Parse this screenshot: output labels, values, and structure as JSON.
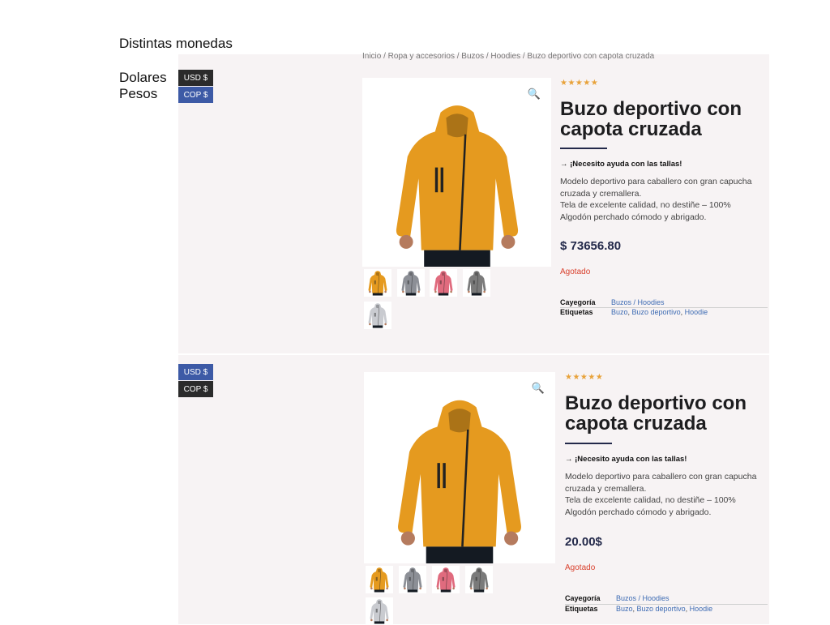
{
  "document": {
    "title": "Distintas monedas",
    "labels": [
      "Dolares",
      "Pesos"
    ]
  },
  "colors": {
    "hoodie": "#e59a1f",
    "hoodie_gray": "#8c8f96",
    "hoodie_pink": "#e06b7e",
    "hoodie_darkgray": "#7a7a7a",
    "hoodie_light": "#c9cbd0",
    "price": "#23294a",
    "stock": "#d9412e",
    "link": "#3d6bb3",
    "stars": "#e8a23a",
    "currency_active": "#3d5aa6",
    "currency_inactive": "#2b2b2b"
  },
  "panels": [
    {
      "currency_buttons": [
        "USD $",
        "COP $"
      ],
      "active_currency": "COP $",
      "breadcrumb": "Inicio / Ropa y accesorios / Buzos / Hoodies / Buzo deportivo con capota cruzada",
      "rating_stars": "★★★★★",
      "rating": 5,
      "product_title": "Buzo deportivo con capota cruzada",
      "help_link": "¡Necesito ayuda con las tallas!",
      "description": [
        "Modelo deportivo para caballero con gran capucha",
        "cruzada y cremallera.",
        "Tela de excelente calidad, no destiñe – 100%",
        "Algodón perchado cómodo y abrigado."
      ],
      "price": "$ 73656.80",
      "stock_status": "Agotado",
      "meta": {
        "category_label": "Cayegoría",
        "category_value": "Buzos / Hoodies",
        "tags_label": "Etiquetas",
        "tags": [
          "Buzo",
          "Buzo deportivo",
          "Hoodie"
        ]
      },
      "thumbnails": [
        "orange-hoodie",
        "gray-hoodie",
        "pink-hoodie",
        "darkgray-hoodie",
        "light-hoodie"
      ]
    },
    {
      "currency_buttons": [
        "USD $",
        "COP $"
      ],
      "active_currency": "USD $",
      "rating_stars": "★★★★★",
      "rating": 5,
      "product_title": "Buzo deportivo con capota cruzada",
      "help_link": "¡Necesito ayuda con las tallas!",
      "description": [
        "Modelo deportivo para caballero con gran capucha",
        "cruzada y cremallera.",
        "Tela de excelente calidad, no destiñe – 100%",
        "Algodón perchado cómodo y abrigado."
      ],
      "price": "20.00$",
      "stock_status": "Agotado",
      "meta": {
        "category_label": "Cayegoría",
        "category_value": "Buzos / Hoodies",
        "tags_label": "Etiquetas",
        "tags": [
          "Buzo",
          "Buzo deportivo",
          "Hoodie"
        ]
      },
      "thumbnails": [
        "orange-hoodie",
        "gray-hoodie",
        "pink-hoodie",
        "darkgray-hoodie",
        "light-hoodie"
      ]
    }
  ]
}
